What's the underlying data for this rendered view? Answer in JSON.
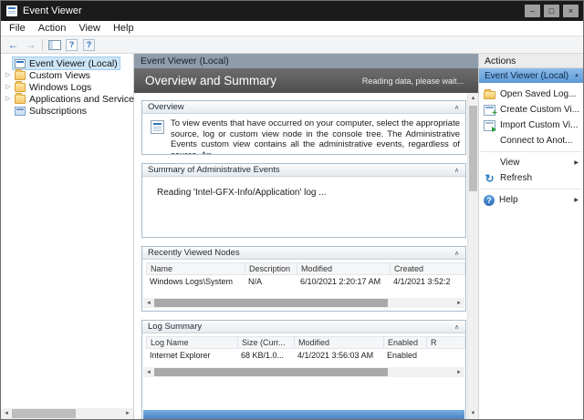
{
  "window": {
    "title": "Event Viewer"
  },
  "icons": {
    "minimize": "–",
    "maximize": "□",
    "close": "×",
    "back": "←",
    "forward": "→",
    "help": "?",
    "expander": "▷",
    "collapse": "∧",
    "submenu": "▶",
    "scroll_left": "◄",
    "scroll_right": "►",
    "scroll_up": "▲",
    "scroll_down": "▼",
    "refresh": "↻"
  },
  "colors": {
    "titlebar": "#1b1b1b",
    "selection_blue": "#cde5f7",
    "actions_selected": "#5e99d5",
    "banner": "#4e4e4e"
  },
  "menu": {
    "items": [
      {
        "label": "File"
      },
      {
        "label": "Action"
      },
      {
        "label": "View"
      },
      {
        "label": "Help"
      }
    ]
  },
  "tree": {
    "items": [
      {
        "label": "Event Viewer (Local)"
      },
      {
        "label": "Custom Views"
      },
      {
        "label": "Windows Logs"
      },
      {
        "label": "Applications and Services Lo"
      },
      {
        "label": "Subscriptions"
      }
    ]
  },
  "center": {
    "header": "Event Viewer (Local)",
    "banner_title": "Overview and Summary",
    "status": "Reading data, please wait...",
    "sections": {
      "overview": {
        "title": "Overview",
        "text": "To view events that have occurred on your computer, select the appropriate source, log or custom view node in the console tree. The Administrative Events custom view contains all the administrative events, regardless of source. An"
      },
      "admin_summary": {
        "title": "Summary of Administrative Events",
        "status": "Reading 'Intel-GFX-Info/Application' log ..."
      },
      "recent_nodes": {
        "title": "Recently Viewed Nodes",
        "columns": [
          "Name",
          "Description",
          "Modified",
          "Created"
        ],
        "rows": [
          [
            "Windows Logs\\System",
            "N/A",
            "6/10/2021 2:20:17 AM",
            "4/1/2021 3:52:2"
          ]
        ]
      },
      "log_summary": {
        "title": "Log Summary",
        "columns": [
          "Log Name",
          "Size (Curr...",
          "Modified",
          "Enabled",
          "R"
        ],
        "rows": [
          [
            "Internet Explorer",
            "68 KB/1.0...",
            "4/1/2021 3:56:03 AM",
            "Enabled",
            ""
          ]
        ]
      }
    }
  },
  "actions": {
    "header": "Actions",
    "selected_group": "Event Viewer (Local)",
    "items": [
      {
        "label": "Open Saved Log..."
      },
      {
        "label": "Create Custom Vi..."
      },
      {
        "label": "Import Custom Vi..."
      },
      {
        "label": "Connect to Anot..."
      },
      {
        "label": "View"
      },
      {
        "label": "Refresh"
      },
      {
        "label": "Help"
      }
    ]
  }
}
